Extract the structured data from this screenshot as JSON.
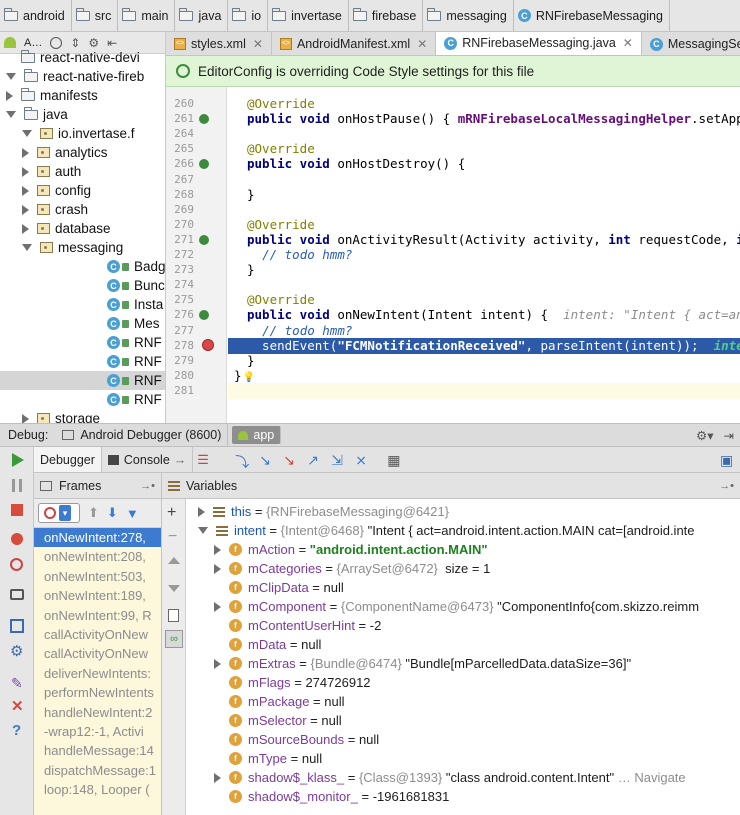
{
  "breadcrumb": [
    "android",
    "src",
    "main",
    "java",
    "io",
    "invertase",
    "firebase",
    "messaging",
    "RNFirebaseMessaging"
  ],
  "project": {
    "toolbar_label": "A…",
    "items": [
      {
        "label": "react-native-devi",
        "depth": 1,
        "kind": "folder",
        "state": "none"
      },
      {
        "label": "react-native-fireb",
        "depth": 0,
        "kind": "folder",
        "state": "open"
      },
      {
        "label": "manifests",
        "depth": 1,
        "kind": "folder",
        "state": "closed"
      },
      {
        "label": "java",
        "depth": 1,
        "kind": "folder",
        "state": "open"
      },
      {
        "label": "io.invertase.f",
        "depth": 2,
        "kind": "package",
        "state": "open"
      },
      {
        "label": "analytics",
        "depth": 3,
        "kind": "package",
        "state": "closed"
      },
      {
        "label": "auth",
        "depth": 3,
        "kind": "package",
        "state": "closed"
      },
      {
        "label": "config",
        "depth": 3,
        "kind": "package",
        "state": "closed"
      },
      {
        "label": "crash",
        "depth": 3,
        "kind": "package",
        "state": "closed"
      },
      {
        "label": "database",
        "depth": 3,
        "kind": "package",
        "state": "closed"
      },
      {
        "label": "messaging",
        "depth": 3,
        "kind": "package",
        "state": "open"
      },
      {
        "label": "Badg",
        "depth": 4,
        "kind": "class",
        "state": "none"
      },
      {
        "label": "Bunc",
        "depth": 4,
        "kind": "class",
        "state": "none"
      },
      {
        "label": "Insta",
        "depth": 4,
        "kind": "class",
        "state": "none"
      },
      {
        "label": "Mes",
        "depth": 4,
        "kind": "class",
        "state": "none"
      },
      {
        "label": "RNF",
        "depth": 4,
        "kind": "class",
        "state": "none"
      },
      {
        "label": "RNF",
        "depth": 4,
        "kind": "class",
        "state": "none"
      },
      {
        "label": "RNF",
        "depth": 4,
        "kind": "class",
        "state": "selected"
      },
      {
        "label": "RNF",
        "depth": 4,
        "kind": "class",
        "state": "none"
      },
      {
        "label": "storage",
        "depth": 3,
        "kind": "package",
        "state": "closed"
      }
    ]
  },
  "tabs": [
    {
      "label": "styles.xml",
      "icon": "xml-icon",
      "active": false
    },
    {
      "label": "AndroidManifest.xml",
      "icon": "xml-icon",
      "active": false
    },
    {
      "label": "RNFirebaseMessaging.java",
      "icon": "class-icon",
      "active": true
    },
    {
      "label": "MessagingServic",
      "icon": "class-icon",
      "active": false
    }
  ],
  "banner": "EditorConfig is overriding Code Style settings for this file",
  "editor": {
    "lines": [
      {
        "n": "260",
        "html": "<span class=\"ann\">@Override</span>"
      },
      {
        "n": "261",
        "html": "<span class=\"kw\">public void</span> onHostPause() { <span style=\"color:#660e7a;font-weight:bold\">mRNFirebaseLocalMessagingHelper</span>.setApplicat"
      },
      {
        "n": "264",
        "html": ""
      },
      {
        "n": "265",
        "html": "<span class=\"ann\">@Override</span>"
      },
      {
        "n": "266",
        "html": "<span class=\"kw\">public void</span> onHostDestroy() {"
      },
      {
        "n": "267",
        "html": ""
      },
      {
        "n": "268",
        "html": "}"
      },
      {
        "n": "269",
        "html": ""
      },
      {
        "n": "270",
        "html": "<span class=\"ann\">@Override</span>"
      },
      {
        "n": "271",
        "html": "<span class=\"kw\">public void</span> onActivityResult(Activity activity, <span class=\"kw\">int</span> requestCode, <span class=\"kw\">int</span> re"
      },
      {
        "n": "272",
        "html": "  <span class=\"cm\">// todo hmm?</span>"
      },
      {
        "n": "273",
        "html": "}"
      },
      {
        "n": "274",
        "html": ""
      },
      {
        "n": "275",
        "html": "<span class=\"ann\">@Override</span>"
      },
      {
        "n": "276",
        "html": "<span class=\"kw\">public void</span> onNewIntent(Intent intent) {  <span class=\"hint\">intent: \"Intent { act=androi</span>"
      },
      {
        "n": "277",
        "html": "  <span class=\"cm\">// todo hmm?</span>"
      },
      {
        "n": "278",
        "html": "  sendEvent(<span style=\"font-weight:bold\">\"FCMNotificationReceived\"</span>, parseIntent(intent));  <span style=\"color:#4fd08a;font-style:italic;font-weight:bold\">intent: \"</span>"
      },
      {
        "n": "279",
        "html": "}"
      },
      {
        "n": "280",
        "html": "}"
      },
      {
        "n": "281",
        "html": ""
      }
    ]
  },
  "debug": {
    "label": "Debug:",
    "tabs": [
      "Android Debugger (8600)",
      "app"
    ],
    "subtabs": [
      "Debugger",
      "Console"
    ]
  },
  "frames": {
    "title": "Frames",
    "items": [
      "onNewIntent:278, ",
      "onNewIntent:208, ",
      "onNewIntent:503, ",
      "onNewIntent:189, ",
      "onNewIntent:99, R",
      "callActivityOnNew",
      "callActivityOnNew",
      "deliverNewIntents:",
      "performNewIntents",
      "handleNewIntent:2",
      "-wrap12:-1, Activi",
      "handleMessage:14",
      "dispatchMessage:1",
      "loop:148, Looper ("
    ]
  },
  "variables": {
    "title": "Variables",
    "items": [
      {
        "depth": 0,
        "expand": "closed",
        "icon": "lines",
        "name": "this",
        "eq": " = ",
        "ref": "{RNFirebaseMessaging@6421}",
        "value": ""
      },
      {
        "depth": 0,
        "expand": "open",
        "icon": "lines",
        "name": "intent",
        "eq": " = ",
        "ref": "{Intent@6468}",
        "value": " \"Intent { act=android.intent.action.MAIN cat=[android.inte"
      },
      {
        "depth": 1,
        "expand": "closed",
        "icon": "f",
        "name": "mAction",
        "eq": " = ",
        "ref": "",
        "value": "\"android.intent.action.MAIN\"",
        "green": true
      },
      {
        "depth": 1,
        "expand": "closed",
        "icon": "f",
        "name": "mCategories",
        "eq": " = ",
        "ref": "{ArraySet@6472}",
        "value": "  size = 1"
      },
      {
        "depth": 1,
        "expand": "none",
        "icon": "f",
        "name": "mClipData",
        "eq": " = ",
        "ref": "",
        "value": "null"
      },
      {
        "depth": 1,
        "expand": "closed",
        "icon": "f",
        "name": "mComponent",
        "eq": " = ",
        "ref": "{ComponentName@6473}",
        "value": " \"ComponentInfo{com.skizzo.reimm"
      },
      {
        "depth": 1,
        "expand": "none",
        "icon": "f",
        "name": "mContentUserHint",
        "eq": " = ",
        "ref": "",
        "value": "-2"
      },
      {
        "depth": 1,
        "expand": "none",
        "icon": "f",
        "name": "mData",
        "eq": " = ",
        "ref": "",
        "value": "null"
      },
      {
        "depth": 1,
        "expand": "closed",
        "icon": "f",
        "name": "mExtras",
        "eq": " = ",
        "ref": "{Bundle@6474}",
        "value": " \"Bundle[mParcelledData.dataSize=36]\""
      },
      {
        "depth": 1,
        "expand": "none",
        "icon": "f",
        "name": "mFlags",
        "eq": " = ",
        "ref": "",
        "value": "274726912"
      },
      {
        "depth": 1,
        "expand": "none",
        "icon": "f",
        "name": "mPackage",
        "eq": " = ",
        "ref": "",
        "value": "null"
      },
      {
        "depth": 1,
        "expand": "none",
        "icon": "f",
        "name": "mSelector",
        "eq": " = ",
        "ref": "",
        "value": "null"
      },
      {
        "depth": 1,
        "expand": "none",
        "icon": "f",
        "name": "mSourceBounds",
        "eq": " = ",
        "ref": "",
        "value": "null"
      },
      {
        "depth": 1,
        "expand": "none",
        "icon": "f",
        "name": "mType",
        "eq": " = ",
        "ref": "",
        "value": "null"
      },
      {
        "depth": 1,
        "expand": "closed",
        "icon": "f",
        "name": "shadow$_klass_",
        "eq": " = ",
        "ref": "{Class@1393}",
        "value": " \"class android.content.Intent\"",
        "extra": " … Navigate"
      },
      {
        "depth": 1,
        "expand": "none",
        "icon": "f",
        "name": "shadow$_monitor_",
        "eq": " = ",
        "ref": "",
        "value": "-1961681831"
      }
    ]
  }
}
